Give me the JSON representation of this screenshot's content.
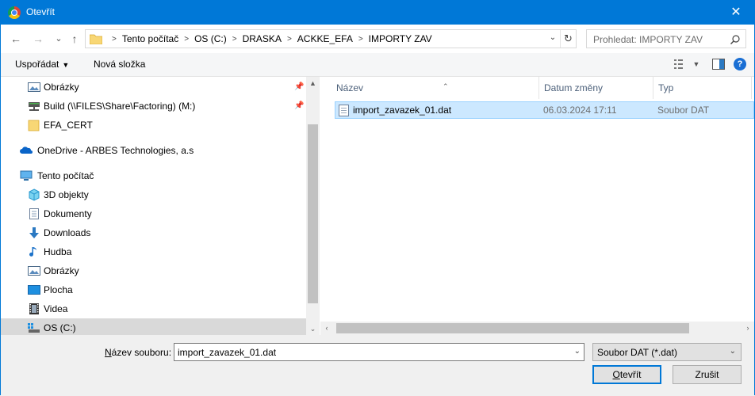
{
  "window": {
    "title": "Otevřít",
    "close_glyph": "✕"
  },
  "nav": {
    "back_glyph": "←",
    "forward_glyph": "→",
    "recent_glyph": "⌄",
    "up_glyph": "↑",
    "breadcrumbs": [
      "Tento počítač",
      "OS (C:)",
      "DRASKA",
      "ACKKE_EFA",
      "IMPORTY ZAV"
    ],
    "refresh_glyph": "↻",
    "search_placeholder": "Prohledat: IMPORTY ZAV"
  },
  "toolbar": {
    "organize_label": "Uspořádat",
    "new_folder_label": "Nová složka",
    "help_label": "?"
  },
  "tree": [
    {
      "label": "Obrázky",
      "icon": "pictures-icon",
      "pinned": true
    },
    {
      "label": "Build (\\\\FILES\\Share\\Factoring) (M:)",
      "icon": "network-drive-icon",
      "pinned": true
    },
    {
      "label": "EFA_CERT",
      "icon": "folder-icon",
      "pinned": false
    },
    {
      "label": "OneDrive - ARBES Technologies, a.s",
      "icon": "onedrive-icon",
      "pinned": false
    },
    {
      "label": "Tento počítač",
      "icon": "computer-icon",
      "pinned": false
    },
    {
      "label": "3D objekty",
      "icon": "3d-objects-icon",
      "pinned": false
    },
    {
      "label": "Dokumenty",
      "icon": "documents-icon",
      "pinned": false
    },
    {
      "label": "Downloads",
      "icon": "downloads-icon",
      "pinned": false
    },
    {
      "label": "Hudba",
      "icon": "music-icon",
      "pinned": false
    },
    {
      "label": "Obrázky",
      "icon": "pictures-icon",
      "pinned": false
    },
    {
      "label": "Plocha",
      "icon": "desktop-icon",
      "pinned": false
    },
    {
      "label": "Videa",
      "icon": "videos-icon",
      "pinned": false
    },
    {
      "label": "OS (C:)",
      "icon": "drive-icon",
      "pinned": false,
      "selected": true
    }
  ],
  "columns": {
    "name": "Název",
    "date": "Datum změny",
    "type": "Typ"
  },
  "files": [
    {
      "name": "import_zavazek_01.dat",
      "date": "06.03.2024 17:11",
      "type": "Soubor DAT",
      "selected": true
    }
  ],
  "bottom": {
    "filename_label_prefix": "N",
    "filename_label_rest": "ázev souboru:",
    "filename_value": "import_zavazek_01.dat",
    "filter_value": "Soubor DAT (*.dat)",
    "open_label_prefix": "O",
    "open_label_rest": "tevřít",
    "cancel_label": "Zrušit"
  },
  "colors": {
    "accent": "#0078d7",
    "selection": "#cce8ff"
  }
}
